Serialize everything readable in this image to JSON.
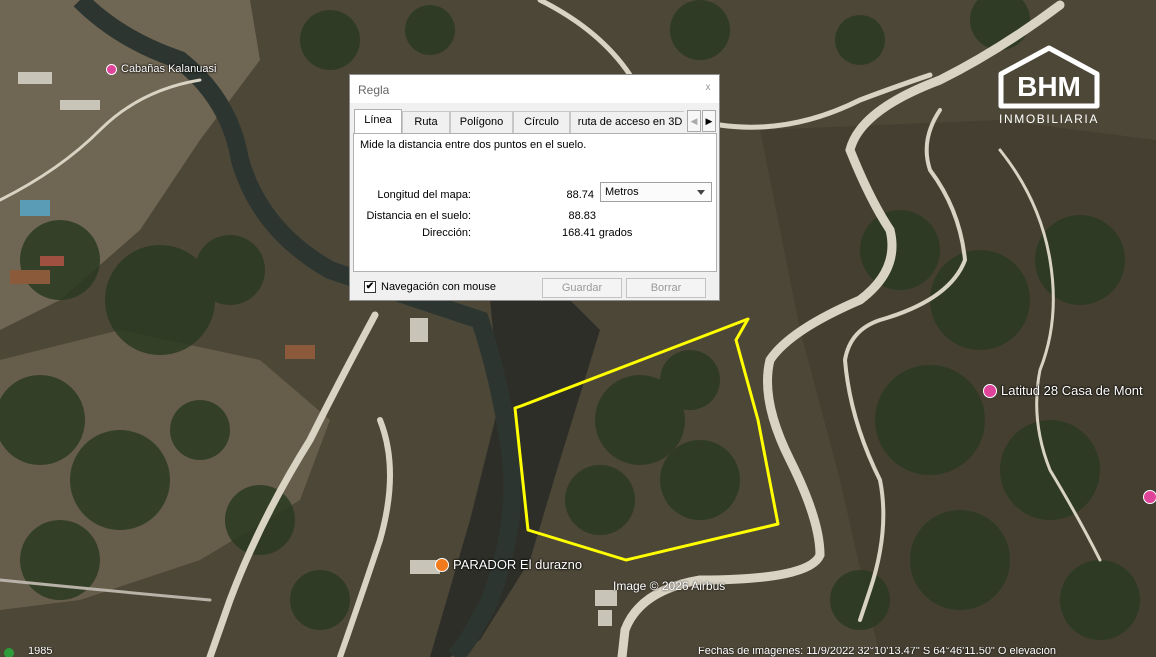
{
  "map": {
    "pois": {
      "kalanuasi": "Cabañas Kalanuasi",
      "latitud": "Latitud 28 Casa de Mont",
      "parador": "PARADOR El durazno"
    },
    "credit": "Image © 2026 Airbus",
    "status_year": "1985",
    "status_right": "Fechas de imágenes: 11/9/2022     32°10'13.47\" S    64°46'11.50\" O    elevación"
  },
  "logo": {
    "brand": "BHM",
    "subtitle": "INMOBILIARIA"
  },
  "dialog": {
    "title": "Regla",
    "close_glyph": "x",
    "tabs": [
      "Línea",
      "Ruta",
      "Polígono",
      "Círculo",
      "ruta de acceso en 3D"
    ],
    "active_tab": "Línea",
    "description": "Mide la distancia entre dos puntos en el suelo.",
    "map_length_label": "Longitud del mapa:",
    "map_length_value": "88.74",
    "unit": "Metros",
    "ground_distance_label": "Distancia en el suelo:",
    "ground_distance_value": "88.83",
    "direction_label": "Dirección:",
    "direction_value": "168.41 grados",
    "mouse_nav_checked": true,
    "mouse_nav_label": "Navegación con mouse",
    "save_label": "Guardar",
    "clear_label": "Borrar",
    "arrow_left": "◀",
    "arrow_right": "▶",
    "check_glyph": "✔"
  },
  "colors": {
    "polygon": "#ffff00",
    "road": "#d9d3c4",
    "terrain": "#4a4536",
    "vegetation": "#2b3a22"
  }
}
